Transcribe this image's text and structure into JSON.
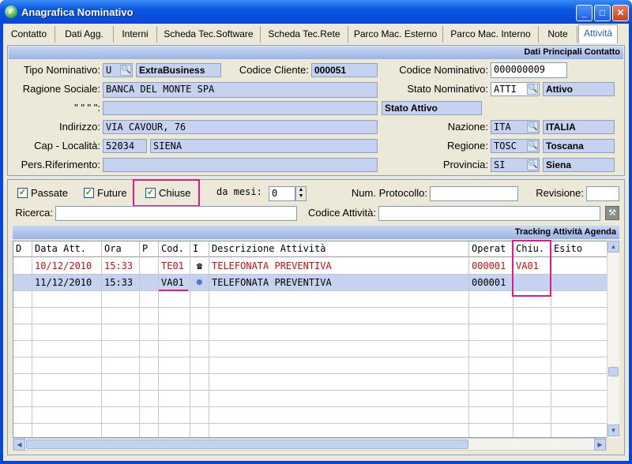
{
  "window": {
    "title": "Anagrafica Nominativo"
  },
  "tabs": [
    "Contatto",
    "Dati Agg.",
    "Interni",
    "Scheda Tec.Software",
    "Scheda Tec.Rete",
    "Parco Mac. Esterno",
    "Parco Mac. Interno",
    "Note",
    "Attività"
  ],
  "active_tab": "Attività",
  "contact_section": {
    "header": "Dati Principali Contatto",
    "tipo_nominativo": {
      "label": "Tipo Nominativo:",
      "code": "U",
      "value": "ExtraBusiness"
    },
    "codice_cliente": {
      "label": "Codice Cliente:",
      "value": "000051"
    },
    "codice_nominativo": {
      "label": "Codice Nominativo:",
      "value": "000000009"
    },
    "ragione_sociale": {
      "label": "Ragione Sociale:",
      "value": "BANCA DEL MONTE SPA"
    },
    "stato_nominativo": {
      "label": "Stato Nominativo:",
      "code": "ATTI",
      "value": "Attivo"
    },
    "ditto": {
      "label": "\"  \"  \"  \":",
      "value": "",
      "status": "Stato Attivo"
    },
    "indirizzo": {
      "label": "Indirizzo:",
      "value": "VIA CAVOUR, 76"
    },
    "nazione": {
      "label": "Nazione:",
      "code": "ITA",
      "value": "ITALIA"
    },
    "cap_localita": {
      "label": "Cap - Località:",
      "cap": "52034",
      "city": "SIENA"
    },
    "regione": {
      "label": "Regione:",
      "code": "TOSC",
      "value": "Toscana"
    },
    "pers_riferimento": {
      "label": "Pers.Riferimento:",
      "value": ""
    },
    "provincia": {
      "label": "Provincia:",
      "code": "SI",
      "value": "Siena"
    }
  },
  "filters": {
    "passate": {
      "label": "Passate",
      "checked": true
    },
    "future": {
      "label": "Future",
      "checked": true
    },
    "chiuse": {
      "label": "Chiuse",
      "checked": true
    },
    "da_mesi_label": "da mesi:",
    "da_mesi_value": "0",
    "num_protocollo_label": "Num. Protocollo:",
    "num_protocollo_value": "",
    "revisione_label": "Revisione:",
    "revisione_value": "",
    "ricerca_label": "Ricerca:",
    "ricerca_value": "",
    "codice_attivita_label": "Codice Attività:",
    "codice_attivita_value": ""
  },
  "grid": {
    "header": "Tracking Attività Agenda",
    "columns": [
      "D",
      "Data Att.",
      "Ora",
      "P",
      "Cod.",
      "I",
      "Descrizione Attività",
      "Operat",
      "Chiu.",
      "Esito"
    ],
    "rows": [
      {
        "d": "",
        "data": "10/12/2010",
        "ora": "15:33",
        "p": "",
        "cod": "TE01",
        "icon": "phone-icon",
        "descr": "TELEFONATA PREVENTIVA",
        "operat": "000001",
        "chiu": "VA01",
        "esito": "",
        "color": "red"
      },
      {
        "d": "",
        "data": "11/12/2010",
        "ora": "15:33",
        "p": "",
        "cod": "VA01",
        "icon": "person-icon",
        "descr": "TELEFONATA PREVENTIVA",
        "operat": "000001",
        "chiu": "",
        "esito": "",
        "color": "black"
      }
    ]
  },
  "colors": {
    "accent_pink": "#e01a8c",
    "field_blue": "#c6d3f0",
    "red_text": "#d01010"
  }
}
